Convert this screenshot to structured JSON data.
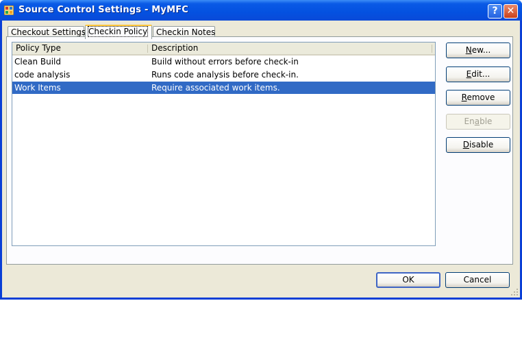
{
  "window": {
    "title": "Source Control Settings - MyMFC",
    "help_label": "?",
    "close_label": "✕"
  },
  "tabs": [
    {
      "label": "Checkout Settings"
    },
    {
      "label": "Checkin Policy"
    },
    {
      "label": "Checkin Notes"
    }
  ],
  "policy_list": {
    "columns": [
      "Policy Type",
      "Description"
    ],
    "rows": [
      {
        "type": "Clean Build",
        "description": "Build without errors before check-in"
      },
      {
        "type": "code analysis",
        "description": "Runs code analysis before check-in."
      },
      {
        "type": "Work Items",
        "description": "Require associated work items.",
        "selected": true
      }
    ]
  },
  "buttons": {
    "new": {
      "mnemonic": "N",
      "rest": "ew..."
    },
    "edit": {
      "mnemonic": "E",
      "rest": "dit..."
    },
    "remove": {
      "mnemonic": "R",
      "rest": "emove"
    },
    "enable": {
      "pre": "En",
      "mnemonic": "a",
      "rest": "ble",
      "enabled": false
    },
    "disable": {
      "mnemonic": "D",
      "rest": "isable"
    }
  },
  "dialog": {
    "ok_label": "OK",
    "cancel_label": "Cancel"
  },
  "colors": {
    "title_bar": "#0451e0",
    "selection": "#316ac5",
    "dialog_face": "#ece9d8"
  }
}
